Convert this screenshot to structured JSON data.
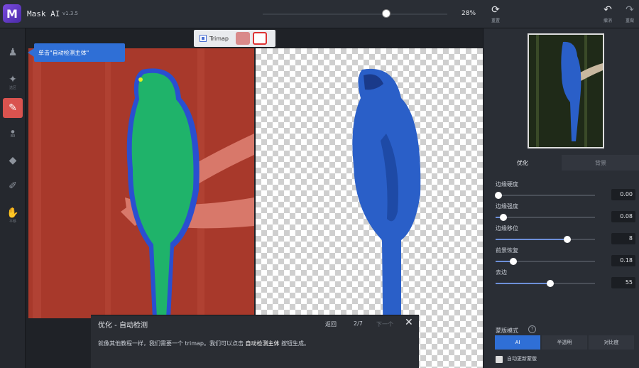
{
  "app": {
    "logo_letter": "M",
    "name": "Mask AI",
    "version": "v1.3.5"
  },
  "topbar": {
    "zoom_value": "28%",
    "buttons": [
      {
        "label": "重置",
        "icon": "refresh-icon"
      },
      {
        "label": "撤消",
        "icon": "undo-icon"
      },
      {
        "label": "重做",
        "icon": "redo-icon"
      }
    ]
  },
  "toolbar": {
    "tools": [
      {
        "label": "",
        "icon": "subject-icon"
      },
      {
        "label": "选区",
        "icon": "wand-icon"
      },
      {
        "label": "",
        "icon": "brush-icon",
        "active": true
      },
      {
        "label": "80",
        "icon": "brush-size-icon"
      },
      {
        "label": "",
        "icon": "fill-bucket-icon"
      },
      {
        "label": "",
        "icon": "pen-icon"
      },
      {
        "label": "平移",
        "icon": "hand-icon"
      }
    ]
  },
  "canvas": {
    "trimap_label": "Trimap",
    "callout": "单击\"自动检测主体\""
  },
  "tutorial": {
    "title": "优化 - 自动检测",
    "back": "返回",
    "page": "2/7",
    "next": "下一个",
    "close": "✕",
    "body_pre": "就像其他教程一样，我们需要一个 trimap。我们可以点击 ",
    "body_bold": "自动检测主体",
    "body_post": " 按钮生成。"
  },
  "panel": {
    "tabs": [
      "优化",
      "背景"
    ],
    "sliders": [
      {
        "label": "边缘硬度",
        "value": "0.00",
        "level": 0.03
      },
      {
        "label": "边缘强度",
        "value": "0.08",
        "level": 0.08
      },
      {
        "label": "边缘移位",
        "value": "8",
        "level": 0.72
      },
      {
        "label": "前景恢复",
        "value": "0.18",
        "level": 0.18
      },
      {
        "label": "去边",
        "value": "55",
        "level": 0.55
      }
    ],
    "mask_mode_title": "蒙版模式",
    "mask_help": "?",
    "modes": [
      "AI",
      "半透明",
      "对比度"
    ],
    "auto_update_label": "自动更新蒙版"
  },
  "colors": {
    "accent": "#2f6fd6",
    "active_tool": "#d9534f",
    "parrot_mask": "#1fb36a",
    "parrot_cut": "#2a5fc8"
  }
}
